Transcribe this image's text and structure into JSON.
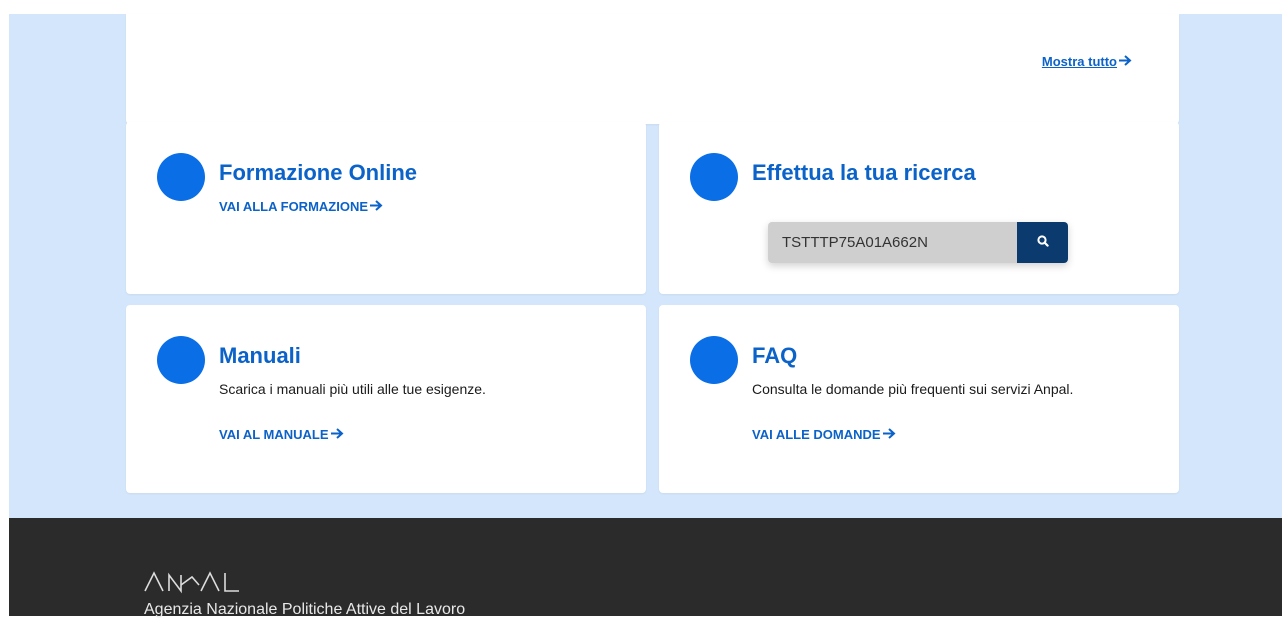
{
  "top_card": {
    "show_all_label": "Mostra tutto"
  },
  "arrow_glyph": "🡒",
  "cards": {
    "formazione": {
      "title": "Formazione Online",
      "link": "VAI ALLA FORMAZIONE"
    },
    "ricerca": {
      "title": "Effettua la tua ricerca",
      "search_value": "TSTTTP75A01A662N",
      "search_icon": "search-icon"
    },
    "manuali": {
      "title": "Manuali",
      "description": "Scarica i manuali più utili alle tue esigenze.",
      "link": "VAI AL MANUALE"
    },
    "faq": {
      "title": "FAQ",
      "description": "Consulta le domande più frequenti sui servizi Anpal.",
      "link": "VAI ALLE DOMANDE"
    }
  },
  "footer": {
    "logo_text": "ANPAL",
    "agency_name": "Agenzia Nazionale Politiche Attive del Lavoro"
  },
  "colors": {
    "accent": "#0b62c8",
    "circle": "#0a6ee6",
    "band": "#d4e6fb",
    "footer": "#2b2b2b",
    "search_button": "#0b3a6e"
  }
}
